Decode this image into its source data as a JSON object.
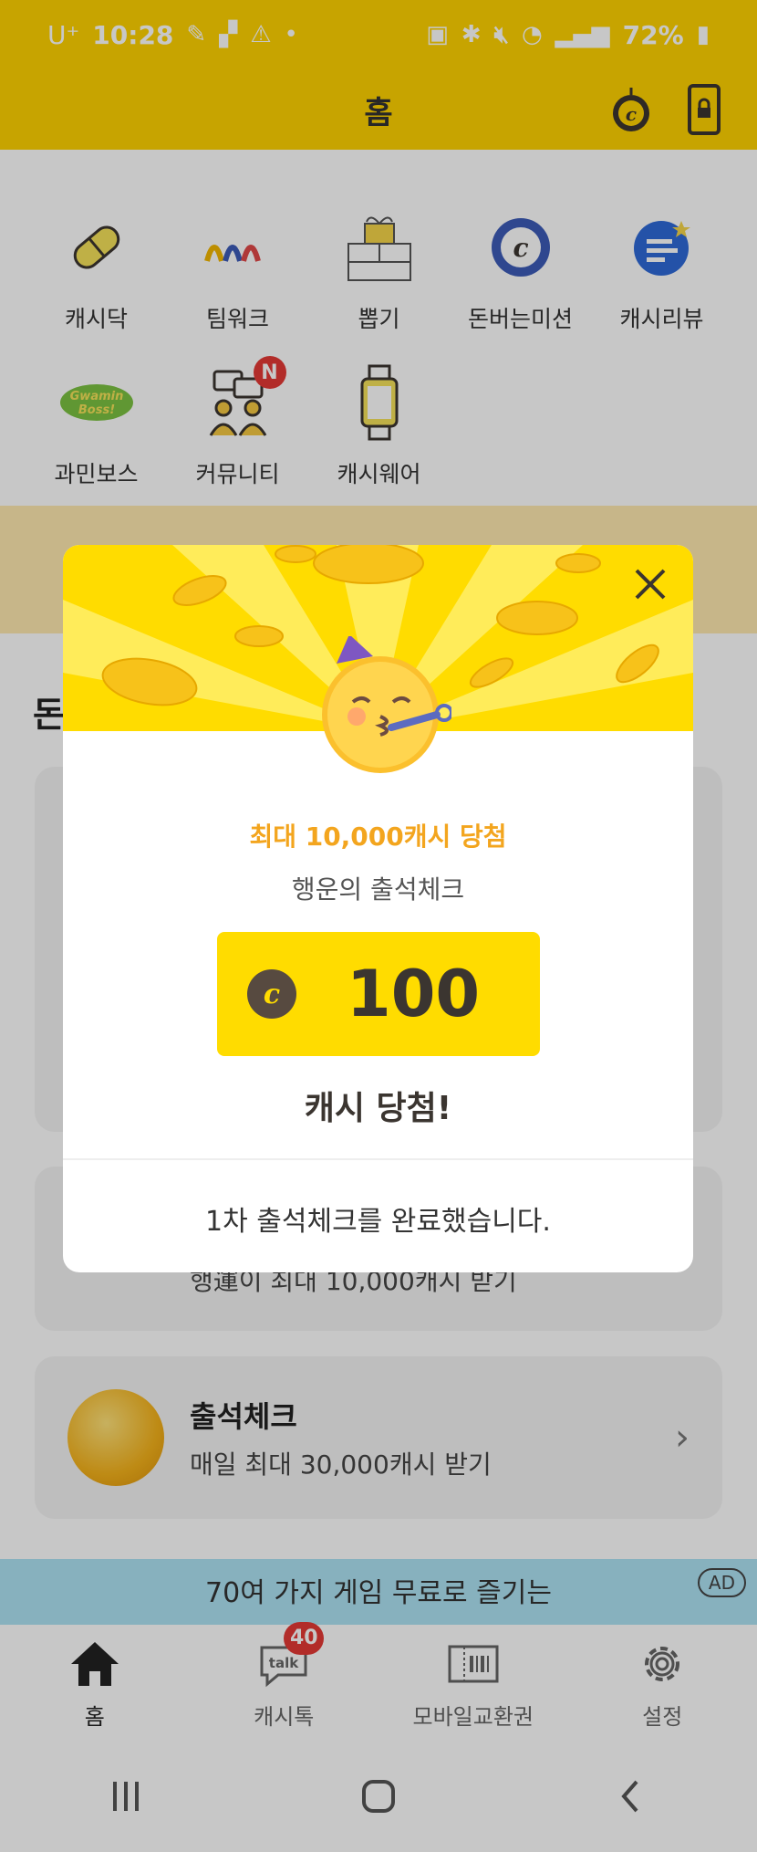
{
  "status_bar": {
    "carrier": "U⁺",
    "time": "10:28",
    "battery": "72%"
  },
  "header": {
    "title": "홈"
  },
  "shortcuts": [
    {
      "label": "캐시닥",
      "icon": "pill-icon"
    },
    {
      "label": "팀워크",
      "icon": "teamwork-icon"
    },
    {
      "label": "뽑기",
      "icon": "gift-icon"
    },
    {
      "label": "돈버는미션",
      "icon": "cash-coin-icon"
    },
    {
      "label": "캐시리뷰",
      "icon": "review-bubble-icon"
    },
    {
      "label": "과민보스",
      "icon": "gwamin-boss-icon"
    },
    {
      "label": "커뮤니티",
      "icon": "community-icon",
      "badge": "N"
    },
    {
      "label": "캐시웨어",
      "icon": "smartwatch-icon"
    }
  ],
  "section": {
    "title_fragment": "돈"
  },
  "cards": {
    "card2_sub": "행運이 최대 10,000캐시 받기",
    "attendance": {
      "title": "출석체크",
      "subtitle": "매일 최대 30,000캐시 받기"
    }
  },
  "ad": {
    "text": "70여 가지 게임 무료로 즐기는",
    "badge": "AD"
  },
  "bottom_nav": [
    {
      "label": "홈",
      "icon": "home-icon",
      "active": true
    },
    {
      "label": "캐시톡",
      "icon": "talk-icon",
      "badge": "40"
    },
    {
      "label": "모바일교환권",
      "icon": "voucher-icon"
    },
    {
      "label": "설정",
      "icon": "settings-gear-icon"
    }
  ],
  "modal": {
    "headline": "최대 10,000캐시 당첨",
    "subtitle": "행운의 출석체크",
    "amount": "100",
    "won_text": "캐시 당첨!",
    "footer_text": "1차 출석체크를 완료했습니다.",
    "accent_color": "#ffdc00",
    "headline_color": "#f3a51e"
  },
  "colors": {
    "brand_yellow": "#ffd200",
    "badge_red": "#e53935"
  }
}
